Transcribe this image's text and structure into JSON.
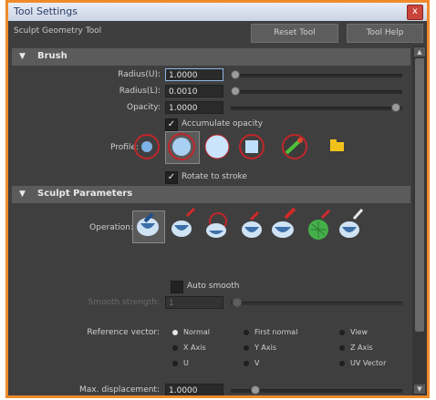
{
  "window": {
    "title": "Tool Settings",
    "close_glyph": "x"
  },
  "toolbar": {
    "tool_name": "Sculpt Geometry Tool",
    "reset_label": "Reset Tool",
    "help_label": "Tool Help"
  },
  "brush": {
    "section_label": "Brush",
    "radius_u_label": "Radius(U):",
    "radius_u_value": "1.0000",
    "radius_l_label": "Radius(L):",
    "radius_l_value": "0.0010",
    "opacity_label": "Opacity:",
    "opacity_value": "1.0000",
    "accumulate_label": "Accumulate opacity",
    "accumulate_checked": true,
    "profile_label": "Profile:",
    "profile_icons": [
      "soft-brush-icon",
      "gaussian-brush-icon",
      "solid-brush-icon",
      "square-brush-icon",
      "browse-brush-icon",
      "folder-icon"
    ],
    "rotate_label": "Rotate to stroke",
    "rotate_checked": true
  },
  "sculpt": {
    "section_label": "Sculpt Parameters",
    "operation_label": "Operation:",
    "operation_icons": [
      "push-icon",
      "pull-icon",
      "smooth-icon",
      "relax-icon",
      "pinch-icon",
      "erase-icon",
      "paint-icon"
    ],
    "auto_smooth_label": "Auto smooth",
    "smooth_strength_label": "Smooth strength:",
    "smooth_strength_value": "1",
    "reference_vector_label": "Reference vector:",
    "reference_options": [
      "Normal",
      "First normal",
      "View",
      "X Axis",
      "Y Axis",
      "Z Axis",
      "U",
      "V",
      "UV Vector"
    ],
    "reference_selected": "Normal",
    "max_displacement_label": "Max. displacement:",
    "max_displacement_value": "1.0000"
  },
  "colors": {
    "frame": "#f08a2a",
    "panel": "#3f3f3f",
    "section": "#5b5b5b",
    "profile_ring": "#c0262a"
  }
}
